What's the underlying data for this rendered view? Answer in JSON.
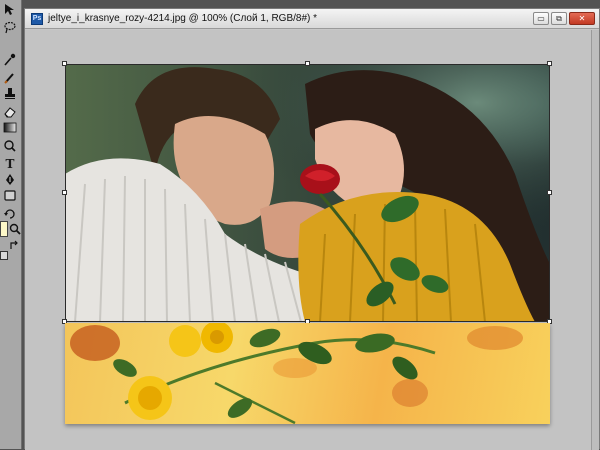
{
  "document": {
    "title": "jeltye_i_krasnye_rozy-4214.jpg @ 100% (Слой 1, RGB/8#) *",
    "app_icon_text": "Ps"
  },
  "window_buttons": {
    "minimize": "▭",
    "restore": "⧉",
    "close": "✕"
  },
  "tools": [
    {
      "name": "move-icon",
      "glyph": "▸"
    },
    {
      "name": "lasso-icon",
      "glyph": "◌"
    },
    {
      "name": "eyedropper-icon",
      "glyph": "✎"
    },
    {
      "name": "brush-icon",
      "glyph": "✏"
    },
    {
      "name": "stamp-icon",
      "glyph": "♙"
    },
    {
      "name": "eraser-icon",
      "glyph": "▭"
    },
    {
      "name": "gradient-icon",
      "glyph": "▤"
    },
    {
      "name": "dodge-icon",
      "glyph": "◍"
    },
    {
      "name": "type-icon",
      "glyph": "T"
    },
    {
      "name": "pen-icon",
      "glyph": "✒"
    },
    {
      "name": "shape-icon",
      "glyph": "▢"
    },
    {
      "name": "rotate-view-icon",
      "glyph": "↻"
    },
    {
      "name": "zoom-icon",
      "glyph": "⌕"
    },
    {
      "name": "swap-colors-icon",
      "glyph": "↰"
    }
  ],
  "colors": {
    "foreground_swatch": "#fdf8c8",
    "workspace": "#535353",
    "canvas_bg": "#c3c3c3"
  }
}
